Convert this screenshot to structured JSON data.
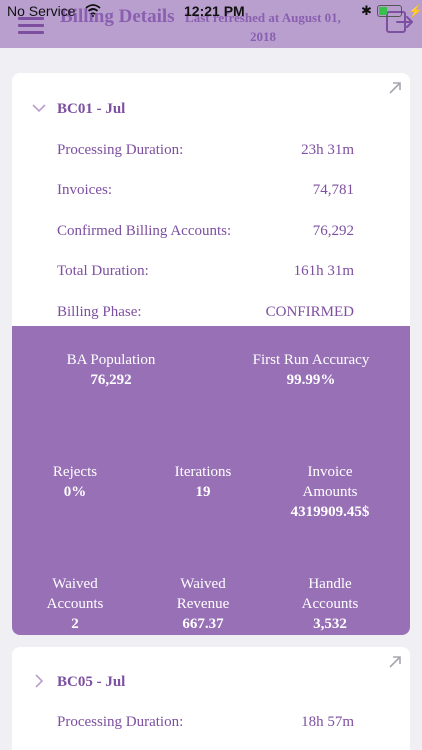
{
  "status_bar": {
    "carrier": "No Service",
    "time": "12:21 PM",
    "bluetooth": "✱",
    "charging": "⚡"
  },
  "header": {
    "title": "Billing Details",
    "subtitle": "Last refreshed at August 01, 2018"
  },
  "cards": [
    {
      "title": "BC01 - Jul",
      "rows": [
        {
          "label": "Processing Duration:",
          "value": "23h 31m"
        },
        {
          "label": "Invoices:",
          "value": "74,781"
        },
        {
          "label": "Confirmed Billing Accounts:",
          "value": "76,292"
        },
        {
          "label": "Total Duration:",
          "value": "161h 31m"
        },
        {
          "label": "Billing Phase:",
          "value": "CONFIRMED"
        }
      ],
      "stats": {
        "ba_population": {
          "label": "BA Population",
          "value": "76,292"
        },
        "first_run_accuracy": {
          "label": "First Run Accuracy",
          "value": "99.99%"
        },
        "rejects": {
          "label": "Rejects",
          "value": "0%"
        },
        "iterations": {
          "label": "Iterations",
          "value": "19"
        },
        "invoice_amounts": {
          "label1": "Invoice",
          "label2": "Amounts",
          "value": "4319909.45$"
        },
        "waived_accounts": {
          "label1": "Waived",
          "label2": "Accounts",
          "value": "2"
        },
        "waived_revenue": {
          "label1": "Waived",
          "label2": "Revenue",
          "value": "667.37"
        },
        "handle_accounts": {
          "label1": "Handle",
          "label2": "Accounts",
          "value": "3,532"
        }
      }
    },
    {
      "title": "BC05 - Jul",
      "rows": [
        {
          "label": "Processing Duration:",
          "value": "18h 57m"
        }
      ]
    }
  ],
  "colors": {
    "header_bg": "#b99fce",
    "accent": "#7d4fa0",
    "panel": "#9870b6",
    "page_bg": "#f0eff4"
  }
}
